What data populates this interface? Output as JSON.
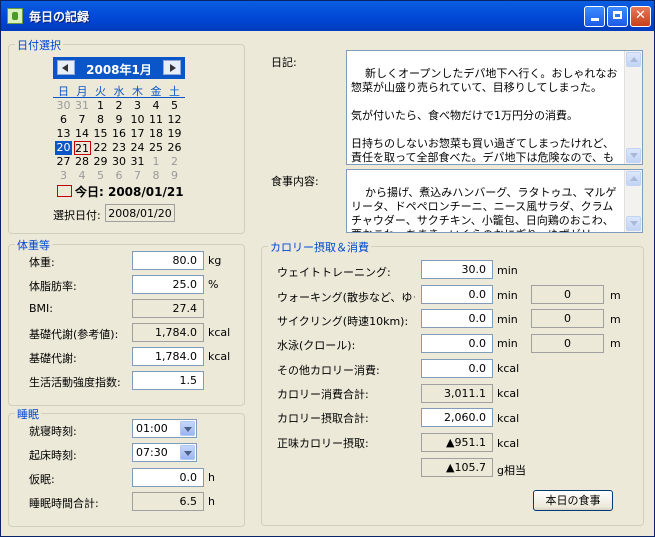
{
  "window": {
    "title": "毎日の記録"
  },
  "icons": {
    "app": "app-icon",
    "minimize": "minimize-icon",
    "maximize": "maximize-icon",
    "close": "close-icon"
  },
  "date_group": {
    "title": "日付選択",
    "calendar": {
      "month_title": "2008年1月",
      "weekdays": [
        "日",
        "月",
        "火",
        "水",
        "木",
        "金",
        "土"
      ],
      "weeks": [
        [
          "30",
          "31",
          "1",
          "2",
          "3",
          "4",
          "5"
        ],
        [
          "6",
          "7",
          "8",
          "9",
          "10",
          "11",
          "12"
        ],
        [
          "13",
          "14",
          "15",
          "16",
          "17",
          "18",
          "19"
        ],
        [
          "20",
          "21",
          "22",
          "23",
          "24",
          "25",
          "26"
        ],
        [
          "27",
          "28",
          "29",
          "30",
          "31",
          "1",
          "2"
        ],
        [
          "3",
          "4",
          "5",
          "6",
          "7",
          "8",
          "9"
        ]
      ],
      "selected_day": "20",
      "today_day": "21",
      "today_label": "今日: 2008/01/21"
    },
    "selected_label": "選択日付:",
    "selected_value": "2008/01/20"
  },
  "diary": {
    "label": "日記:",
    "text": "新しくオープンしたデパ地下へ行く。おしゃれなお惣菜が山盛り売られていて、目移りしてしまった。\n\n気が付いたら、食べ物だけで1万円分の消費。\n\n日持ちのしないお惣菜も買い過ぎてしまったけれど、責任を取って全部食べた。デパ地下は危険なので、もう行くのはやめよう……。"
  },
  "meal": {
    "label": "食事内容:",
    "text": "から揚げ、煮込みハンバーグ、ラタトゥユ、マルゲリータ、ドペペロンチーニ、ニース風サラダ、クラムチャウダー、サクチキン、小籠包、日向鶏のおこわ、栗おこわ、ちまき、いくらのおにぎり、ゆずゼリー、豆大福"
  },
  "body_group": {
    "title": "体重等",
    "weight": {
      "label": "体重:",
      "value": "80.0",
      "unit": "kg"
    },
    "fat": {
      "label": "体脂肪率:",
      "value": "25.0",
      "unit": "%"
    },
    "bmi": {
      "label": "BMI:",
      "value": "27.4"
    },
    "bmr_ref": {
      "label": "基礎代謝(参考値):",
      "value": "1,784.0",
      "unit": "kcal"
    },
    "bmr": {
      "label": "基礎代謝:",
      "value": "1,784.0",
      "unit": "kcal"
    },
    "activity": {
      "label": "生活活動強度指数:",
      "value": "1.5"
    }
  },
  "sleep_group": {
    "title": "睡眠",
    "bedtime": {
      "label": "就寝時刻:",
      "value": "01:00"
    },
    "wake": {
      "label": "起床時刻:",
      "value": "07:30"
    },
    "nap": {
      "label": "仮眠:",
      "value": "0.0",
      "unit": "h"
    },
    "total": {
      "label": "睡眠時間合計:",
      "value": "6.5",
      "unit": "h"
    }
  },
  "calorie_group": {
    "title": "カロリー摂取＆消費",
    "weight_training": {
      "label": "ウェイトトレーニング:",
      "value": "30.0",
      "unit": "min"
    },
    "walking": {
      "label": "ウォーキング(散歩など、ゆっ",
      "value": "0.0",
      "unit": "min",
      "distance": "0",
      "distance_unit": "m"
    },
    "cycling": {
      "label": "サイクリング(時速10km):",
      "value": "0.0",
      "unit": "min",
      "distance": "0",
      "distance_unit": "m"
    },
    "swimming": {
      "label": "水泳(クロール):",
      "value": "0.0",
      "unit": "min",
      "distance": "0",
      "distance_unit": "m"
    },
    "other": {
      "label": "その他カロリー消費:",
      "value": "0.0",
      "unit": "kcal"
    },
    "burn_total": {
      "label": "カロリー消費合計:",
      "value": "3,011.1",
      "unit": "kcal"
    },
    "intake_total": {
      "label": "カロリー摂取合計:",
      "value": "2,060.0",
      "unit": "kcal"
    },
    "net": {
      "label": "正味カロリー摂取:",
      "value": "▲951.1",
      "unit": "kcal"
    },
    "grams": {
      "value": "▲105.7",
      "unit": "g相当"
    },
    "meal_button": "本日の食事"
  }
}
